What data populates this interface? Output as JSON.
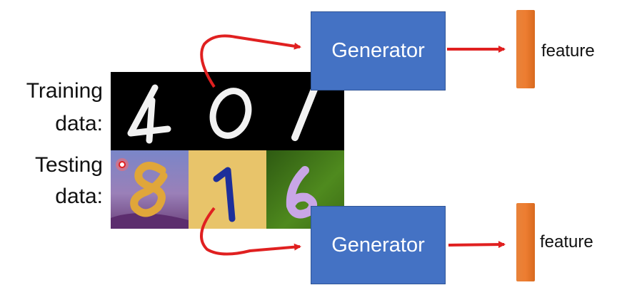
{
  "labels": {
    "training_1": "Training",
    "training_2": "data:",
    "testing_1": "Testing",
    "testing_2": "data:"
  },
  "generators": {
    "top": "Generator",
    "bottom": "Generator"
  },
  "features": {
    "top": "feature",
    "bottom": "feature"
  },
  "training_digits": [
    "4",
    "0",
    "1"
  ],
  "testing_digits": [
    "8",
    "1",
    "6"
  ],
  "colors": {
    "generator_fill": "#4472c4",
    "feature_bar": "#ed7d31",
    "arrow": "#e02020",
    "training_bg": "#000000",
    "cursor": "#e02020"
  }
}
